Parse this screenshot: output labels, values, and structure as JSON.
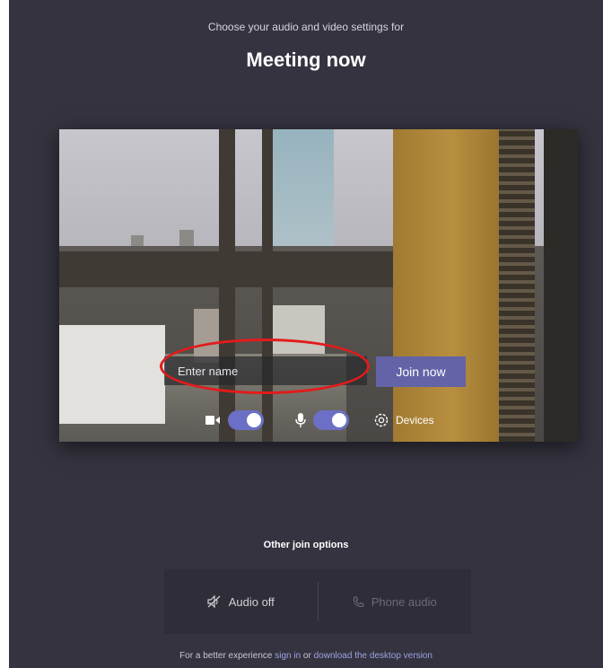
{
  "header": {
    "subtitle": "Choose your audio and video settings for",
    "title": "Meeting now"
  },
  "preview": {
    "name_placeholder": "Enter name",
    "join_label": "Join now",
    "camera_on": true,
    "mic_on": true,
    "devices_label": "Devices"
  },
  "other_options": {
    "title": "Other join options",
    "audio_off_label": "Audio off",
    "phone_audio_label": "Phone audio"
  },
  "footer": {
    "prefix": "For a better experience ",
    "sign_in": "sign in",
    "middle": " or ",
    "download": "download the desktop version"
  },
  "colors": {
    "background": "#34333f",
    "accent": "#6264a7",
    "highlight": "#e31b1b"
  }
}
